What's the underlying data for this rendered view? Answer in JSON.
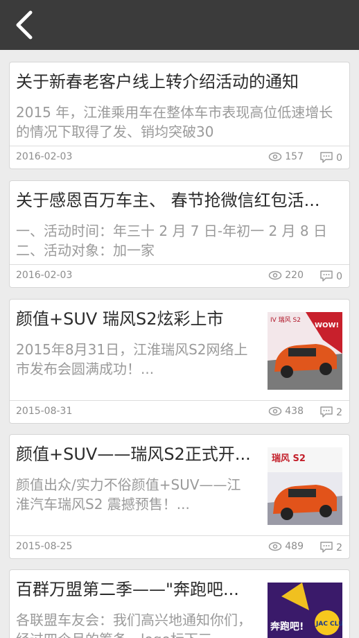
{
  "header": {
    "back_icon": "chevron-left-icon"
  },
  "articles": [
    {
      "title": "关于新春老客户线上转介绍活动的通知",
      "summary": "2015 年，江淮乘用车在整体车市表现高位低速增长的情况下取得了发、销均突破30",
      "date": "2016-02-03",
      "views": "157",
      "comments": "0"
    },
    {
      "title": "关于感恩百万车主、 春节抢微信红包活...",
      "summary": "一、活动时间：年三十 2 月 7 日-年初一 2 月 8 日二、活动对象：加一家",
      "date": "2016-02-03",
      "views": "220",
      "comments": "0"
    },
    {
      "title": "颜值+SUV 瑞风S2炫彩上市",
      "summary": "2015年8月31日，江淮瑞风S2网络上市发布会圆满成功！...",
      "date": "2015-08-31",
      "views": "438",
      "comments": "2"
    },
    {
      "title": "颜值+SUV——瑞风S2正式开...",
      "summary": "颜值出众/实力不俗颜值+SUV——江淮汽车瑞风S2 震撼预售！...",
      "date": "2015-08-25",
      "views": "489",
      "comments": "2"
    },
    {
      "title": "百群万盟第二季——\"奔跑吧...",
      "summary": "各联盟车友会：我们高兴地通知你们，经过四个月的筹备，logo标下三",
      "date": "",
      "views": "",
      "comments": ""
    }
  ],
  "thumbs": [
    {
      "text1": "IV 瑞风 S2",
      "text2": "WOW!"
    },
    {
      "text1": "瑞风 S2",
      "text2": ""
    },
    {
      "text1": "奔跑吧!",
      "text2": "JAC CLUB"
    }
  ],
  "colors": {
    "header_bg": "#3b3b3b",
    "page_bg": "#ececec",
    "card_bg": "#ffffff"
  }
}
